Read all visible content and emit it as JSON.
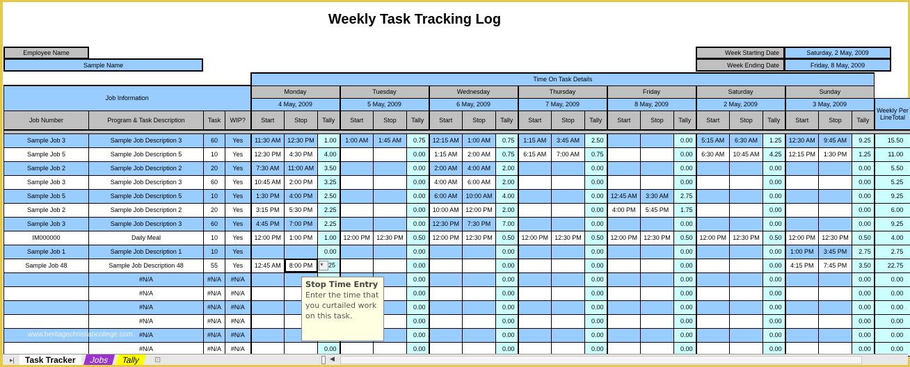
{
  "title": "Weekly Task Tracking Log",
  "employee": {
    "label": "Employee Name",
    "value": "Sample Name"
  },
  "week": {
    "start_label": "Week Starting Date",
    "start_value": "Saturday, 2 May, 2009",
    "end_label": "Week Ending Date",
    "end_value": "Friday, 8 May, 2009"
  },
  "headers": {
    "time_on_task": "Time On Task Details",
    "job_info": "Job Information",
    "weekly_total": "Weekly Per LineTotal",
    "columns": [
      "Job Number",
      "Program & Task Description",
      "Task",
      "WIP?"
    ],
    "start": "Start",
    "stop": "Stop",
    "tally": "Tally"
  },
  "days": [
    {
      "name": "Monday",
      "date": "4 May, 2009"
    },
    {
      "name": "Tuesday",
      "date": "5 May, 2009"
    },
    {
      "name": "Wednesday",
      "date": "6 May, 2009"
    },
    {
      "name": "Thursday",
      "date": "7 May, 2009"
    },
    {
      "name": "Friday",
      "date": "8 May, 2009"
    },
    {
      "name": "Saturday",
      "date": "2 May, 2009"
    },
    {
      "name": "Sunday",
      "date": "3 May, 2009"
    }
  ],
  "rows": [
    {
      "job": "Sample Job 3",
      "desc": "Sample Job Description 3",
      "task": "60",
      "wip": "Yes",
      "days": [
        [
          "11:30 AM",
          "12:30 PM",
          "1.00"
        ],
        [
          "1:00 AM",
          "1:45 AM",
          "0.75"
        ],
        [
          "12:15 AM",
          "1:00 AM",
          "0.75"
        ],
        [
          "1:15 AM",
          "3:45 AM",
          "2.50"
        ],
        [
          "",
          "",
          "0.00"
        ],
        [
          "5:15 AM",
          "6:30 AM",
          "1.25"
        ],
        [
          "12:30 AM",
          "9:45 AM",
          "9.25"
        ]
      ],
      "total": "15.50"
    },
    {
      "job": "Sample Job 5",
      "desc": "Sample Job Description 5",
      "task": "10",
      "wip": "Yes",
      "days": [
        [
          "12:30 PM",
          "4:30 PM",
          "4.00"
        ],
        [
          "",
          "",
          "0.00"
        ],
        [
          "1:15 AM",
          "2:00 AM",
          "0.75"
        ],
        [
          "6:15 AM",
          "7:00 AM",
          "0.75"
        ],
        [
          "",
          "",
          "0.00"
        ],
        [
          "6:30 AM",
          "10:45 AM",
          "4.25"
        ],
        [
          "12:15 PM",
          "1:30 PM",
          "1.25"
        ]
      ],
      "total": "11.00"
    },
    {
      "job": "Sample Job 2",
      "desc": "Sample Job Description 2",
      "task": "20",
      "wip": "Yes",
      "days": [
        [
          "7:30 AM",
          "11:00 AM",
          "3.50"
        ],
        [
          "",
          "",
          "0.00"
        ],
        [
          "2:00 AM",
          "4:00 AM",
          "2.00"
        ],
        [
          "",
          "",
          "0.00"
        ],
        [
          "",
          "",
          "0.00"
        ],
        [
          "",
          "",
          "0.00"
        ],
        [
          "",
          "",
          "0.00"
        ]
      ],
      "total": "5.50"
    },
    {
      "job": "Sample Job 3",
      "desc": "Sample Job Description 3",
      "task": "60",
      "wip": "Yes",
      "days": [
        [
          "10:45 AM",
          "2:00 PM",
          "3.25"
        ],
        [
          "",
          "",
          "0.00"
        ],
        [
          "4:00 AM",
          "6:00 AM",
          "2.00"
        ],
        [
          "",
          "",
          "0.00"
        ],
        [
          "",
          "",
          "0.00"
        ],
        [
          "",
          "",
          "0.00"
        ],
        [
          "",
          "",
          "0.00"
        ]
      ],
      "total": "5.25"
    },
    {
      "job": "Sample Job 5",
      "desc": "Sample Job Description 5",
      "task": "10",
      "wip": "Yes",
      "days": [
        [
          "1:30 PM",
          "4:00 PM",
          "2.50"
        ],
        [
          "",
          "",
          "0.00"
        ],
        [
          "6:00 AM",
          "10:00 AM",
          "4.00"
        ],
        [
          "",
          "",
          "0.00"
        ],
        [
          "12:45 AM",
          "3:30 AM",
          "2.75"
        ],
        [
          "",
          "",
          "0.00"
        ],
        [
          "",
          "",
          "0.00"
        ]
      ],
      "total": "9.25"
    },
    {
      "job": "Sample Job 2",
      "desc": "Sample Job Description 2",
      "task": "20",
      "wip": "Yes",
      "days": [
        [
          "3:15 PM",
          "5:30 PM",
          "2.25"
        ],
        [
          "",
          "",
          "0.00"
        ],
        [
          "10:00 AM",
          "12:00 PM",
          "2.00"
        ],
        [
          "",
          "",
          "0.00"
        ],
        [
          "4:00 PM",
          "5:45 PM",
          "1.75"
        ],
        [
          "",
          "",
          "0.00"
        ],
        [
          "",
          "",
          "0.00"
        ]
      ],
      "total": "6.00"
    },
    {
      "job": "Sample Job 3",
      "desc": "Sample Job Description 3",
      "task": "60",
      "wip": "Yes",
      "days": [
        [
          "4:45 PM",
          "7:00 PM",
          "2.25"
        ],
        [
          "",
          "",
          "0.00"
        ],
        [
          "12:30 PM",
          "7:30 PM",
          "7.00"
        ],
        [
          "",
          "",
          "0.00"
        ],
        [
          "",
          "",
          "0.00"
        ],
        [
          "",
          "",
          "0.00"
        ],
        [
          "",
          "",
          "0.00"
        ]
      ],
      "total": "9.25"
    },
    {
      "job": "IM000000",
      "desc": "Daily Meal",
      "task": "10",
      "wip": "Yes",
      "days": [
        [
          "12:00 PM",
          "1:00 PM",
          "1.00"
        ],
        [
          "12:00 PM",
          "12:30 PM",
          "0.50"
        ],
        [
          "12:00 PM",
          "12:30 PM",
          "0.50"
        ],
        [
          "12:00 PM",
          "12:30 PM",
          "0.50"
        ],
        [
          "12:00 PM",
          "12:30 PM",
          "0.50"
        ],
        [
          "12:00 PM",
          "12:30 PM",
          "0.50"
        ],
        [
          "12:00 PM",
          "12:30 PM",
          "0.50"
        ]
      ],
      "total": "4.00"
    },
    {
      "job": "Sample Job 1",
      "desc": "Sample Job Description 1",
      "task": "10",
      "wip": "Yes",
      "days": [
        [
          "",
          "",
          "0.00"
        ],
        [
          "",
          "",
          "0.00"
        ],
        [
          "",
          "",
          "0.00"
        ],
        [
          "",
          "",
          "0.00"
        ],
        [
          "",
          "",
          "0.00"
        ],
        [
          "",
          "",
          "0.00"
        ],
        [
          "1:00 PM",
          "3:45 PM",
          "2.75"
        ]
      ],
      "total": "2.75"
    },
    {
      "job": "Sample Job 48",
      "desc": "Sample Job Description 48",
      "task": "55",
      "wip": "Yes",
      "days": [
        [
          "12:45 AM",
          "8:00 PM",
          "25"
        ],
        [
          "",
          "",
          "0.00"
        ],
        [
          "",
          "",
          "0.00"
        ],
        [
          "",
          "",
          "0.00"
        ],
        [
          "",
          "",
          "0.00"
        ],
        [
          "",
          "",
          "0.00"
        ],
        [
          "4:15 PM",
          "7:45 PM",
          "3.50"
        ]
      ],
      "total": "22.75"
    },
    {
      "job": "",
      "desc": "#N/A",
      "task": "#N/A",
      "wip": "#N/A",
      "days": [
        [
          "",
          "",
          "0.00"
        ],
        [
          "",
          "",
          "0.00"
        ],
        [
          "",
          "",
          "0.00"
        ],
        [
          "",
          "",
          "0.00"
        ],
        [
          "",
          "",
          "0.00"
        ],
        [
          "",
          "",
          "0.00"
        ],
        [
          "",
          "",
          "0.00"
        ]
      ],
      "total": "0.00"
    },
    {
      "job": "",
      "desc": "#N/A",
      "task": "#N/A",
      "wip": "#N/A",
      "days": [
        [
          "",
          "",
          "0.00"
        ],
        [
          "",
          "",
          "0.00"
        ],
        [
          "",
          "",
          "0.00"
        ],
        [
          "",
          "",
          "0.00"
        ],
        [
          "",
          "",
          "0.00"
        ],
        [
          "",
          "",
          "0.00"
        ],
        [
          "",
          "",
          "0.00"
        ]
      ],
      "total": "0.00"
    },
    {
      "job": "",
      "desc": "#N/A",
      "task": "#N/A",
      "wip": "#N/A",
      "days": [
        [
          "",
          "",
          "0.00"
        ],
        [
          "",
          "",
          "0.00"
        ],
        [
          "",
          "",
          "0.00"
        ],
        [
          "",
          "",
          "0.00"
        ],
        [
          "",
          "",
          "0.00"
        ],
        [
          "",
          "",
          "0.00"
        ],
        [
          "",
          "",
          "0.00"
        ]
      ],
      "total": "0.00"
    },
    {
      "job": "",
      "desc": "#N/A",
      "task": "#N/A",
      "wip": "#N/A",
      "days": [
        [
          "",
          "",
          "0.00"
        ],
        [
          "",
          "",
          "0.00"
        ],
        [
          "",
          "",
          "0.00"
        ],
        [
          "",
          "",
          "0.00"
        ],
        [
          "",
          "",
          "0.00"
        ],
        [
          "",
          "",
          "0.00"
        ],
        [
          "",
          "",
          "0.00"
        ]
      ],
      "total": "0.00"
    },
    {
      "job": "",
      "desc": "#N/A",
      "task": "#N/A",
      "wip": "#N/A",
      "days": [
        [
          "",
          "",
          "0.00"
        ],
        [
          "",
          "",
          "0.00"
        ],
        [
          "",
          "",
          "0.00"
        ],
        [
          "",
          "",
          "0.00"
        ],
        [
          "",
          "",
          "0.00"
        ],
        [
          "",
          "",
          "0.00"
        ],
        [
          "",
          "",
          "0.00"
        ]
      ],
      "total": "0.00"
    },
    {
      "job": "",
      "desc": "#N/A",
      "task": "#N/A",
      "wip": "#N/A",
      "days": [
        [
          "",
          "",
          "0.00"
        ],
        [
          "",
          "",
          "0.00"
        ],
        [
          "",
          "",
          "0.00"
        ],
        [
          "",
          "",
          "0.00"
        ],
        [
          "",
          "",
          "0.00"
        ],
        [
          "",
          "",
          "0.00"
        ],
        [
          "",
          "",
          "0.00"
        ]
      ],
      "total": "0.00"
    }
  ],
  "tooltip": {
    "title": "Stop Time Entry",
    "body": "Enter the time that you curtailed work on this task."
  },
  "watermark": "www.heritagechristiancollege.com",
  "sheet_tabs": [
    {
      "label": "Task Tracker",
      "active": true,
      "color": "#ffffff"
    },
    {
      "label": "Jobs",
      "color": "#9933cc"
    },
    {
      "label": "Tally",
      "color": "#ffff00"
    }
  ],
  "icons": {
    "dropdown": "dropdown-arrow-icon",
    "insert_sheet": "insert-sheet-icon",
    "tab_nav": "tab-nav-last-icon"
  }
}
